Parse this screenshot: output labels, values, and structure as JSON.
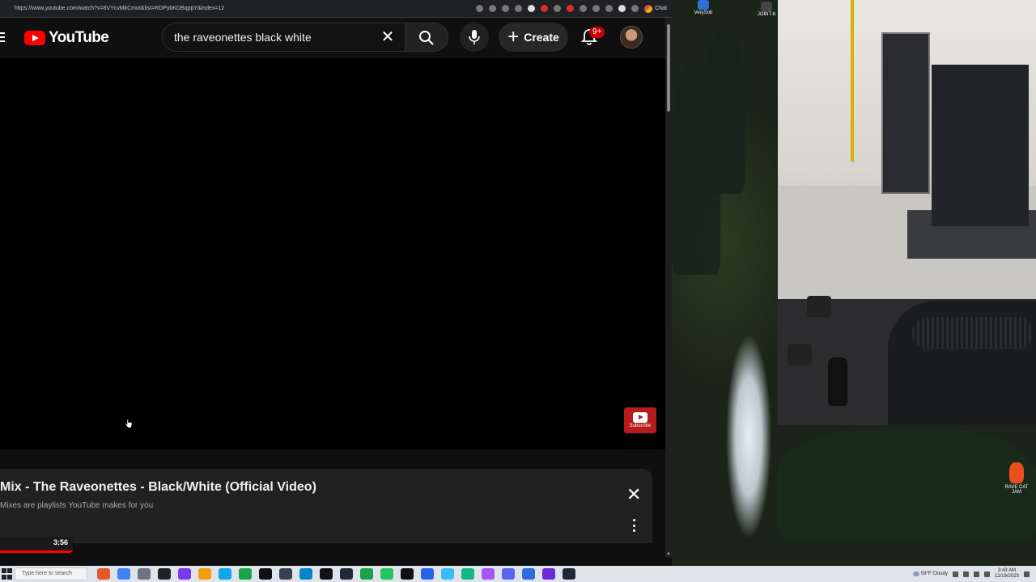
{
  "browser": {
    "url": "https://www.youtube.com/watch?v=8VYcvMkCmoI&list=RDPybKDBqppY&index=12",
    "chat_label": "Chat"
  },
  "youtube": {
    "logo_text": "YouTube",
    "search": {
      "value": "the raveonettes black white",
      "placeholder": "Search"
    },
    "create_label": "Create",
    "notifications_badge": "9+",
    "player": {
      "subscribe_label": "Subscribe"
    },
    "playlist": {
      "title": "Mix - The Raveonettes - Black/White (Official Video)",
      "subtitle": "Mixes are playlists YouTube makes for you",
      "thumb_duration": "3:56"
    }
  },
  "desktop": {
    "icons": [
      {
        "label": "VerySob"
      },
      {
        "label": "JOINT-b"
      },
      {
        "label": "RAVE CAT JAM"
      }
    ]
  },
  "taskbar": {
    "search_placeholder": "Type here to search",
    "weather": "59°F Cloudy",
    "time": "3:43 AM",
    "date": "12/19/2023",
    "app_colors": [
      "#e05a2b",
      "#3b82f6",
      "#6b7280",
      "#222222",
      "#7c3aed",
      "#f59e0b",
      "#0ea5e9",
      "#16a34a",
      "#111111",
      "#374151",
      "#0284c7",
      "#111111",
      "#1f2937",
      "#16a34a",
      "#22c55e",
      "#111111",
      "#2563eb",
      "#38bdf8",
      "#10b981",
      "#a855f7",
      "#5865f2",
      "#2d6cdf",
      "#6d28d9",
      "#1e293b"
    ]
  }
}
